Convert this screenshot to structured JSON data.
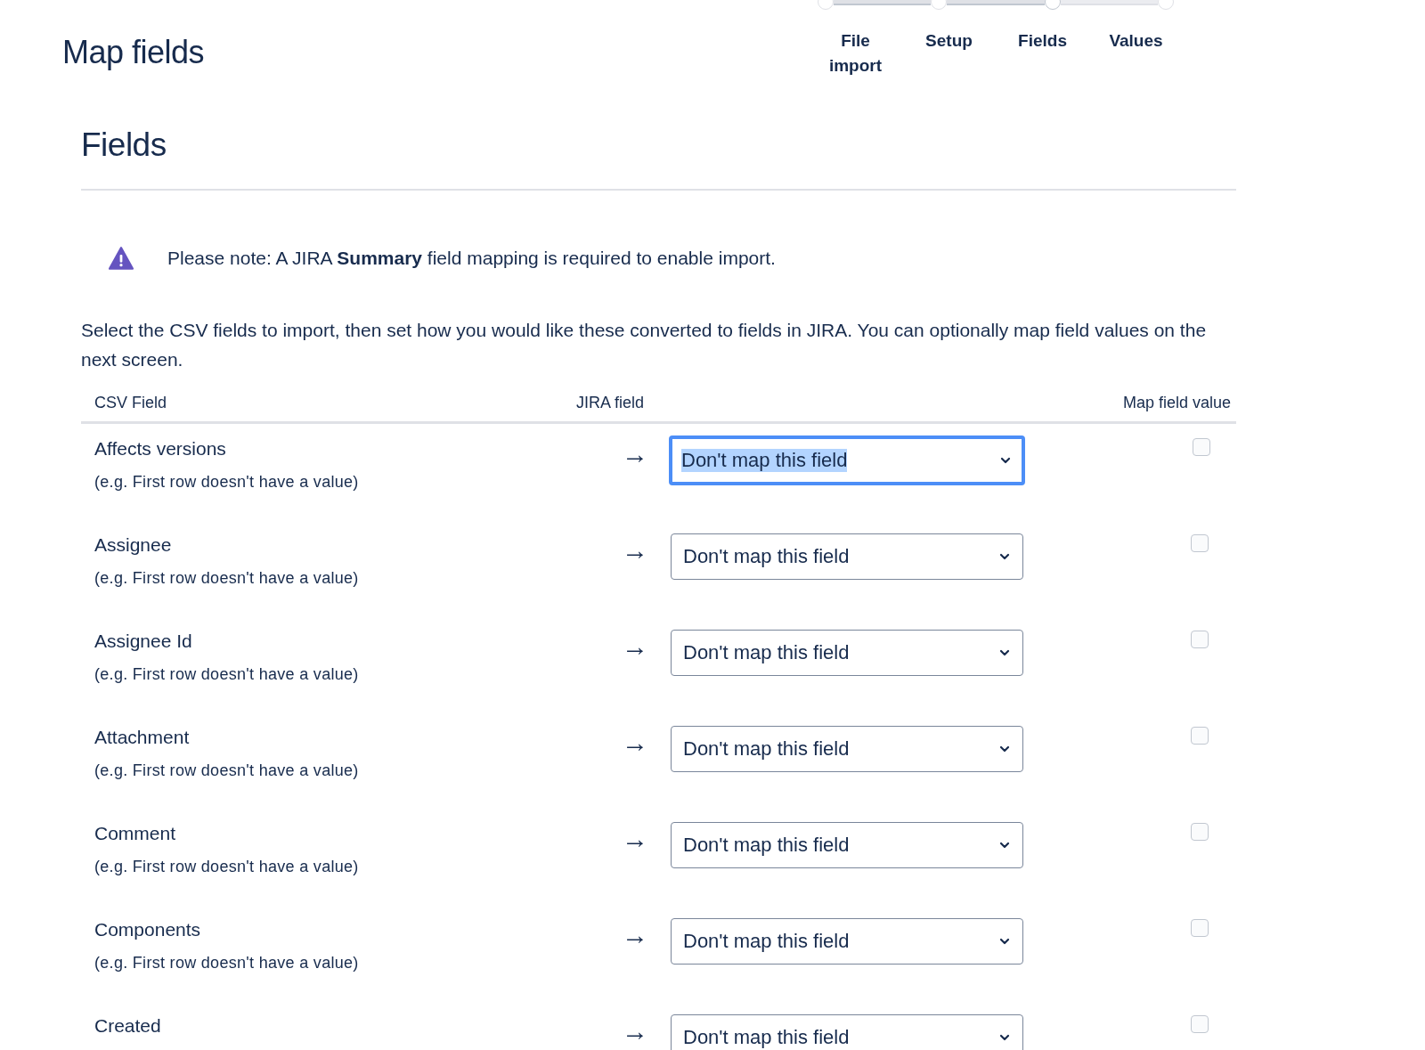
{
  "page_title": "Map fields",
  "steps": [
    {
      "label": "File import",
      "selected": false
    },
    {
      "label": "Setup",
      "selected": false
    },
    {
      "label": "Fields",
      "selected": true
    },
    {
      "label": "Values",
      "selected": false
    }
  ],
  "section_title": "Fields",
  "note": "Please note: A JIRA **Summary** field mapping is required to enable import.",
  "intro": "Select the CSV fields to import, then set how you would like these converted to fields in JIRA. You can optionally map field values on the next screen.",
  "table": {
    "columns": [
      "CSV Field",
      "JIRA field",
      "Map field value"
    ],
    "rows": [
      {
        "name": "Affects versions",
        "example": "(e.g.  First row doesn't have a value)",
        "arrow": "→",
        "value": "Don't map this field",
        "focused": true,
        "checked": false
      },
      {
        "name": "Assignee",
        "example": "(e.g.  First row doesn't have a value)",
        "arrow": "→",
        "value": "Don't map this field",
        "focused": false,
        "checked": false
      },
      {
        "name": "Assignee Id",
        "example": "(e.g.  First row doesn't have a value)",
        "arrow": "→",
        "value": "Don't map this field",
        "focused": false,
        "checked": false
      },
      {
        "name": "Attachment",
        "example": "(e.g.  First row doesn't have a value)",
        "arrow": "→",
        "value": "Don't map this field",
        "focused": false,
        "checked": false
      },
      {
        "name": "Comment",
        "example": "(e.g.  First row doesn't have a value)",
        "arrow": "→",
        "value": "Don't map this field",
        "focused": false,
        "checked": false
      },
      {
        "name": "Components",
        "example": "(e.g.  First row doesn't have a value)",
        "arrow": "→",
        "value": "Don't map this field",
        "focused": false,
        "checked": false
      },
      {
        "name": "Created",
        "arrow": "→",
        "value": "Don't map this field",
        "focused": false,
        "checked": false
      }
    ]
  }
}
